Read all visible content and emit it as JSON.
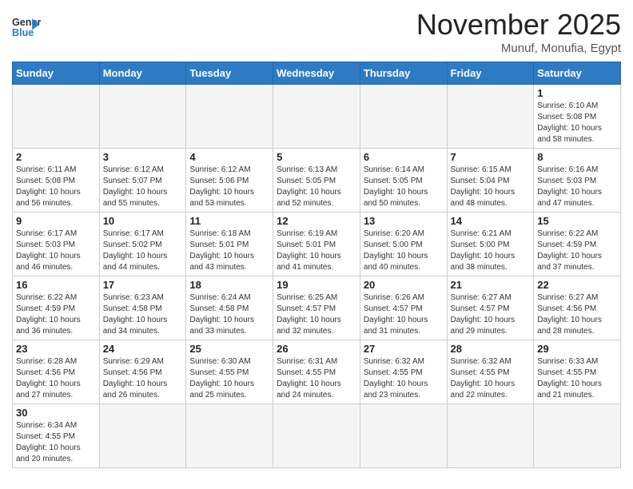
{
  "header": {
    "logo_general": "General",
    "logo_blue": "Blue",
    "month_title": "November 2025",
    "subtitle": "Munuf, Monufia, Egypt"
  },
  "days_of_week": [
    "Sunday",
    "Monday",
    "Tuesday",
    "Wednesday",
    "Thursday",
    "Friday",
    "Saturday"
  ],
  "weeks": [
    [
      {
        "day": "",
        "info": ""
      },
      {
        "day": "",
        "info": ""
      },
      {
        "day": "",
        "info": ""
      },
      {
        "day": "",
        "info": ""
      },
      {
        "day": "",
        "info": ""
      },
      {
        "day": "",
        "info": ""
      },
      {
        "day": "1",
        "info": "Sunrise: 6:10 AM\nSunset: 5:08 PM\nDaylight: 10 hours and 58 minutes."
      }
    ],
    [
      {
        "day": "2",
        "info": "Sunrise: 6:11 AM\nSunset: 5:08 PM\nDaylight: 10 hours and 56 minutes."
      },
      {
        "day": "3",
        "info": "Sunrise: 6:12 AM\nSunset: 5:07 PM\nDaylight: 10 hours and 55 minutes."
      },
      {
        "day": "4",
        "info": "Sunrise: 6:12 AM\nSunset: 5:06 PM\nDaylight: 10 hours and 53 minutes."
      },
      {
        "day": "5",
        "info": "Sunrise: 6:13 AM\nSunset: 5:05 PM\nDaylight: 10 hours and 52 minutes."
      },
      {
        "day": "6",
        "info": "Sunrise: 6:14 AM\nSunset: 5:05 PM\nDaylight: 10 hours and 50 minutes."
      },
      {
        "day": "7",
        "info": "Sunrise: 6:15 AM\nSunset: 5:04 PM\nDaylight: 10 hours and 48 minutes."
      },
      {
        "day": "8",
        "info": "Sunrise: 6:16 AM\nSunset: 5:03 PM\nDaylight: 10 hours and 47 minutes."
      }
    ],
    [
      {
        "day": "9",
        "info": "Sunrise: 6:17 AM\nSunset: 5:03 PM\nDaylight: 10 hours and 46 minutes."
      },
      {
        "day": "10",
        "info": "Sunrise: 6:17 AM\nSunset: 5:02 PM\nDaylight: 10 hours and 44 minutes."
      },
      {
        "day": "11",
        "info": "Sunrise: 6:18 AM\nSunset: 5:01 PM\nDaylight: 10 hours and 43 minutes."
      },
      {
        "day": "12",
        "info": "Sunrise: 6:19 AM\nSunset: 5:01 PM\nDaylight: 10 hours and 41 minutes."
      },
      {
        "day": "13",
        "info": "Sunrise: 6:20 AM\nSunset: 5:00 PM\nDaylight: 10 hours and 40 minutes."
      },
      {
        "day": "14",
        "info": "Sunrise: 6:21 AM\nSunset: 5:00 PM\nDaylight: 10 hours and 38 minutes."
      },
      {
        "day": "15",
        "info": "Sunrise: 6:22 AM\nSunset: 4:59 PM\nDaylight: 10 hours and 37 minutes."
      }
    ],
    [
      {
        "day": "16",
        "info": "Sunrise: 6:22 AM\nSunset: 4:59 PM\nDaylight: 10 hours and 36 minutes."
      },
      {
        "day": "17",
        "info": "Sunrise: 6:23 AM\nSunset: 4:58 PM\nDaylight: 10 hours and 34 minutes."
      },
      {
        "day": "18",
        "info": "Sunrise: 6:24 AM\nSunset: 4:58 PM\nDaylight: 10 hours and 33 minutes."
      },
      {
        "day": "19",
        "info": "Sunrise: 6:25 AM\nSunset: 4:57 PM\nDaylight: 10 hours and 32 minutes."
      },
      {
        "day": "20",
        "info": "Sunrise: 6:26 AM\nSunset: 4:57 PM\nDaylight: 10 hours and 31 minutes."
      },
      {
        "day": "21",
        "info": "Sunrise: 6:27 AM\nSunset: 4:57 PM\nDaylight: 10 hours and 29 minutes."
      },
      {
        "day": "22",
        "info": "Sunrise: 6:27 AM\nSunset: 4:56 PM\nDaylight: 10 hours and 28 minutes."
      }
    ],
    [
      {
        "day": "23",
        "info": "Sunrise: 6:28 AM\nSunset: 4:56 PM\nDaylight: 10 hours and 27 minutes."
      },
      {
        "day": "24",
        "info": "Sunrise: 6:29 AM\nSunset: 4:56 PM\nDaylight: 10 hours and 26 minutes."
      },
      {
        "day": "25",
        "info": "Sunrise: 6:30 AM\nSunset: 4:55 PM\nDaylight: 10 hours and 25 minutes."
      },
      {
        "day": "26",
        "info": "Sunrise: 6:31 AM\nSunset: 4:55 PM\nDaylight: 10 hours and 24 minutes."
      },
      {
        "day": "27",
        "info": "Sunrise: 6:32 AM\nSunset: 4:55 PM\nDaylight: 10 hours and 23 minutes."
      },
      {
        "day": "28",
        "info": "Sunrise: 6:32 AM\nSunset: 4:55 PM\nDaylight: 10 hours and 22 minutes."
      },
      {
        "day": "29",
        "info": "Sunrise: 6:33 AM\nSunset: 4:55 PM\nDaylight: 10 hours and 21 minutes."
      }
    ],
    [
      {
        "day": "30",
        "info": "Sunrise: 6:34 AM\nSunset: 4:55 PM\nDaylight: 10 hours and 20 minutes."
      },
      {
        "day": "",
        "info": ""
      },
      {
        "day": "",
        "info": ""
      },
      {
        "day": "",
        "info": ""
      },
      {
        "day": "",
        "info": ""
      },
      {
        "day": "",
        "info": ""
      },
      {
        "day": "",
        "info": ""
      }
    ]
  ]
}
